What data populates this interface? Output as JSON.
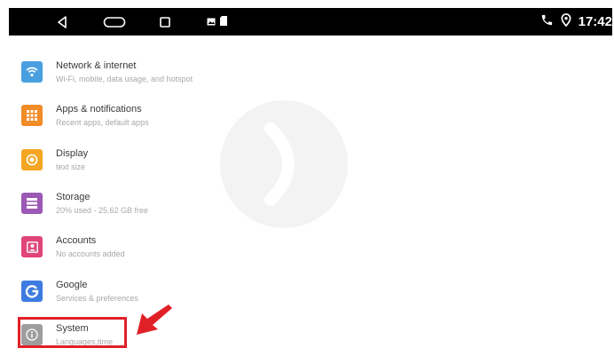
{
  "status_bar": {
    "time": "17:42",
    "icons": [
      "back-icon",
      "home-icon",
      "recents-icon",
      "image-notification-icon",
      "sd-card-icon",
      "phone-icon",
      "location-icon"
    ]
  },
  "settings": {
    "items": [
      {
        "title": "Network & internet",
        "subtitle": "Wi-Fi, mobile, data usage, and hotspot",
        "icon": "wifi-icon",
        "color": "#4a9fe0"
      },
      {
        "title": "Apps & notifications",
        "subtitle": "Recent apps, default apps",
        "icon": "apps-grid-icon",
        "color": "#f28c28"
      },
      {
        "title": "Display",
        "subtitle": "text size",
        "icon": "brightness-icon",
        "color": "#f5a623"
      },
      {
        "title": "Storage",
        "subtitle": "20% used - 25.62 GB free",
        "icon": "storage-icon",
        "color": "#9b59b6"
      },
      {
        "title": "Accounts",
        "subtitle": "No accounts added",
        "icon": "account-icon",
        "color": "#e0447a"
      },
      {
        "title": "Google",
        "subtitle": "Services & preferences",
        "icon": "google-icon",
        "color": "#3d7be0"
      },
      {
        "title": "System",
        "subtitle": "Languages,time",
        "icon": "info-icon",
        "color": "#9e9e9e"
      }
    ]
  },
  "annotation": {
    "color": "#e02027"
  }
}
